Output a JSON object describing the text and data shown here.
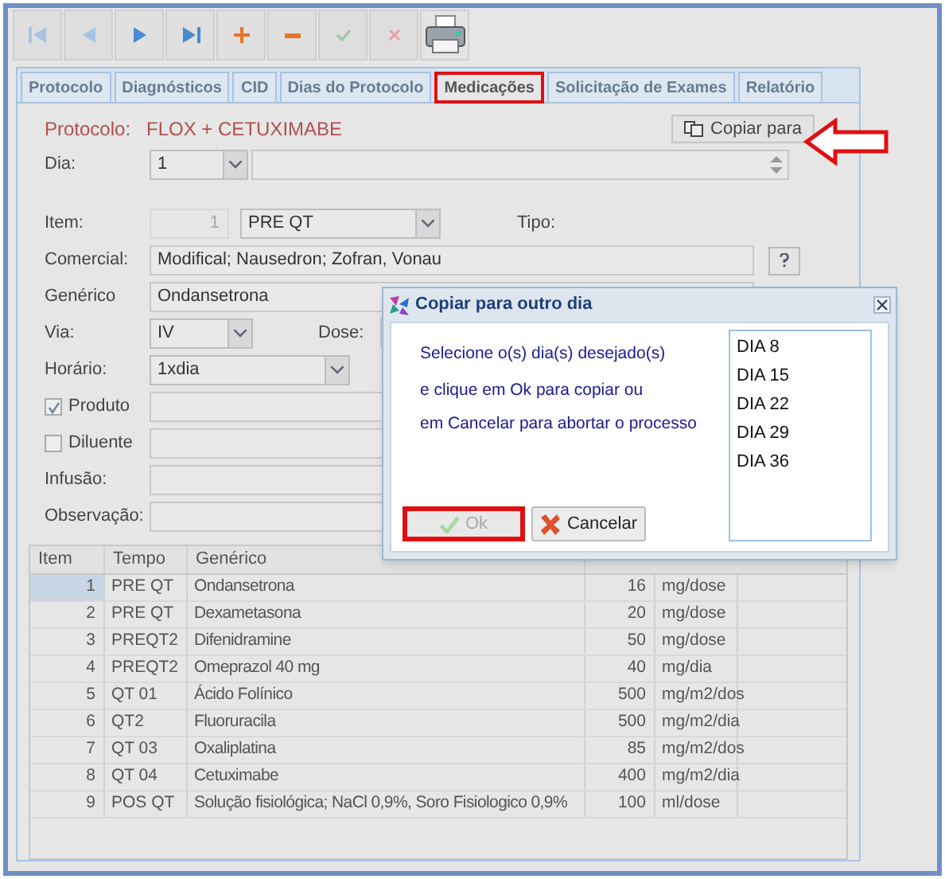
{
  "toolbar": [
    {
      "kind": "first",
      "disabled": true
    },
    {
      "kind": "prev",
      "disabled": true
    },
    {
      "kind": "next",
      "disabled": false
    },
    {
      "kind": "last",
      "disabled": false
    },
    {
      "kind": "add",
      "disabled": false
    },
    {
      "kind": "remove",
      "disabled": false
    },
    {
      "kind": "save",
      "disabled": true
    },
    {
      "kind": "cancel",
      "disabled": true
    },
    {
      "kind": "print",
      "disabled": false
    }
  ],
  "tabs": [
    {
      "label": "Protocolo",
      "selected": false,
      "highlighted": false
    },
    {
      "label": "Diagnósticos",
      "selected": false,
      "highlighted": false
    },
    {
      "label": "CID",
      "selected": false,
      "highlighted": false
    },
    {
      "label": "Dias do Protocolo",
      "selected": false,
      "highlighted": false
    },
    {
      "label": "Medicações",
      "selected": true,
      "highlighted": true
    },
    {
      "label": "Solicitação de Exames",
      "selected": false,
      "highlighted": false
    },
    {
      "label": "Relatório",
      "selected": false,
      "highlighted": false
    }
  ],
  "protocol": {
    "label": "Protocolo:",
    "value": "FLOX + CETUXIMABE"
  },
  "copy_button": {
    "label": "Copiar para",
    "highlighted": true
  },
  "day": {
    "label": "Dia:",
    "value": "1"
  },
  "form": {
    "item_label": "Item:",
    "item_number": "1",
    "item_value": "PRE QT",
    "type_label": "Tipo:",
    "commercial_label": "Comercial:",
    "commercial_value": "Modifical; Nausedron; Zofran, Vonau",
    "generic_label": "Genérico",
    "generic_value": "Ondansetrona",
    "route_label": "Via:",
    "route_value": "IV",
    "dose_label": "Dose:",
    "schedule_label": "Horário:",
    "schedule_value": "1xdia",
    "product_label": "Produto",
    "product_checked": true,
    "diluent_label": "Diluente",
    "diluent_checked": false,
    "infusion_label": "Infusão:",
    "observation_label": "Observação:"
  },
  "table": {
    "columns": [
      "Item",
      "Tempo",
      "Genérico"
    ],
    "rows": [
      {
        "item": "1",
        "tempo": "PRE QT",
        "generico": "Ondansetrona",
        "dose": "16",
        "unit": "mg/dose",
        "selected": true
      },
      {
        "item": "2",
        "tempo": "PRE QT",
        "generico": "Dexametasona",
        "dose": "20",
        "unit": "mg/dose",
        "selected": false
      },
      {
        "item": "3",
        "tempo": "PREQT2",
        "generico": "Difenidramine",
        "dose": "50",
        "unit": "mg/dose",
        "selected": false
      },
      {
        "item": "4",
        "tempo": "PREQT2",
        "generico": "Omeprazol 40 mg",
        "dose": "40",
        "unit": "mg/dia",
        "selected": false
      },
      {
        "item": "5",
        "tempo": "QT 01",
        "generico": "Ácido Folínico",
        "dose": "500",
        "unit": "mg/m2/dos",
        "selected": false
      },
      {
        "item": "6",
        "tempo": "QT2",
        "generico": "Fluoruracila",
        "dose": "500",
        "unit": "mg/m2/dia",
        "selected": false
      },
      {
        "item": "7",
        "tempo": "QT 03",
        "generico": "Oxaliplatina",
        "dose": "85",
        "unit": "mg/m2/dos",
        "selected": false
      },
      {
        "item": "8",
        "tempo": "QT 04",
        "generico": "Cetuximabe",
        "dose": "400",
        "unit": "mg/m2/dia",
        "selected": false
      },
      {
        "item": "9",
        "tempo": "POS QT",
        "generico": "Solução fisiológica; NaCl 0,9%, Soro Fisiologico 0,9%",
        "dose": "100",
        "unit": "ml/dose",
        "selected": false
      }
    ]
  },
  "dialog": {
    "title": "Copiar para outro dia",
    "lines": [
      "Selecione o(s) dia(s) desejado(s)",
      "e clique em Ok para copiar ou",
      "em Cancelar para abortar o processo"
    ],
    "days": [
      {
        "label": "DIA 8",
        "selected": false
      },
      {
        "label": "DIA 15",
        "selected": false
      },
      {
        "label": "DIA 22",
        "selected": false
      },
      {
        "label": "DIA 29",
        "selected": false
      },
      {
        "label": "DIA 36",
        "selected": false
      }
    ],
    "ok": {
      "label": "Ok",
      "disabled": true,
      "highlighted": true
    },
    "cancel": {
      "label": "Cancelar"
    }
  }
}
